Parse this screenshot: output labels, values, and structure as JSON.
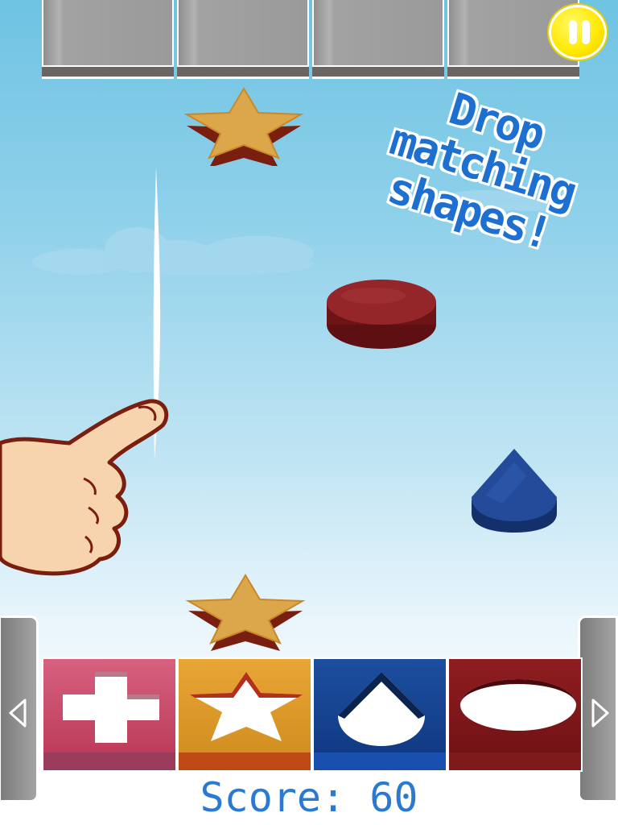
{
  "hint": {
    "lines": [
      "Drop",
      "matching",
      "shapes!"
    ]
  },
  "score": {
    "label": "Score:",
    "value": "60"
  },
  "colors": {
    "star": "#d9a13a",
    "circle": "#8a1d1f",
    "drop": "#1d3f86",
    "bin_cross": "#c03a5e",
    "bin_star": "#d99622",
    "bin_drop": "#123f8a",
    "bin_circle": "#7f1417",
    "pause": "#ffe800",
    "text_blue": "#2a7ad3"
  },
  "icons": {
    "pause": "pause-icon",
    "left": "arrow-left-icon",
    "right": "arrow-right-icon",
    "hand": "pointing-hand-icon"
  }
}
